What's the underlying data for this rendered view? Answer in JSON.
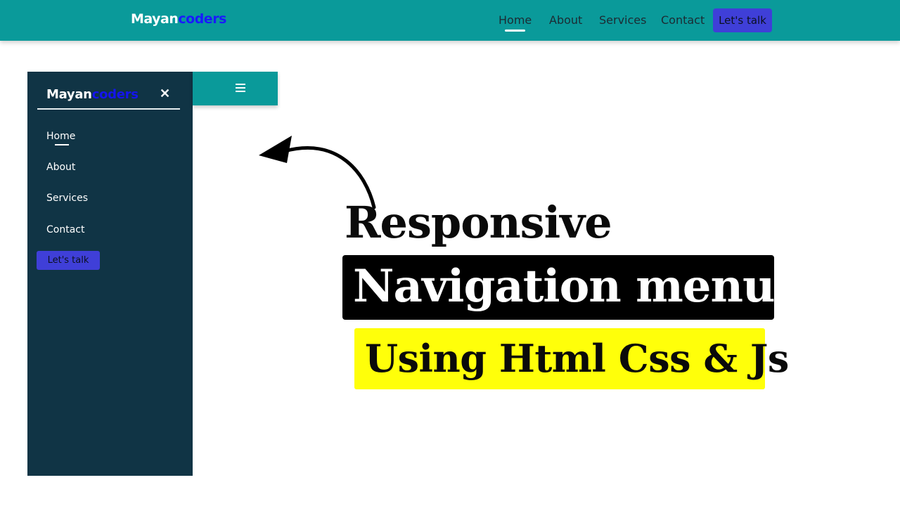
{
  "topbar": {
    "brand_part1": "Mayan",
    "brand_part2": "coders",
    "nav": [
      "Home",
      "About",
      "Services",
      "Contact"
    ],
    "cta": "Let's talk",
    "bg_color": "#0a9a9a",
    "cta_color": "#3f3fd8"
  },
  "sidebar": {
    "brand_part1": "Mayan",
    "brand_part2": "coders",
    "close_icon": "close-icon",
    "items": [
      "Home",
      "About",
      "Services",
      "Contact"
    ],
    "cta": "Let's talk",
    "bg_color": "#103445"
  },
  "mobile_bar": {
    "icon": "hamburger-icon"
  },
  "headline": {
    "line1": "Responsive",
    "line2": "Navigation menu",
    "line3": "Using Html Css & Js",
    "highlight_color": "#ffff0a"
  }
}
